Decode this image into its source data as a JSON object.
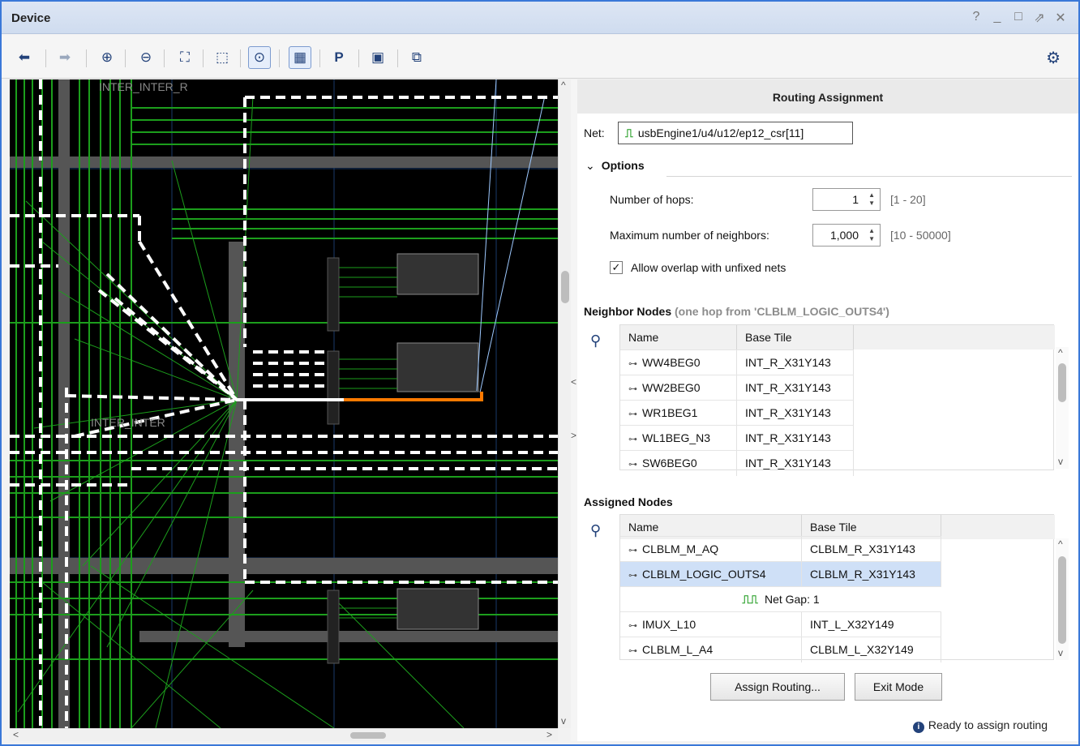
{
  "window": {
    "title": "Device",
    "controls": [
      "?",
      "_",
      "□",
      "⇗",
      "✕"
    ]
  },
  "toolbar": {
    "buttons": [
      {
        "icon": "back-arrow-icon",
        "glyph": "⬅"
      },
      {
        "icon": "forward-arrow-icon",
        "glyph": "➡"
      },
      {
        "icon": "zoom-in-icon",
        "glyph": "⊕"
      },
      {
        "icon": "zoom-out-icon",
        "glyph": "⊖"
      },
      {
        "icon": "zoom-fit-icon",
        "glyph": "⛶"
      },
      {
        "icon": "zoom-selected-icon",
        "glyph": "⬚"
      },
      {
        "icon": "autofit-selection-icon",
        "glyph": "⊙"
      },
      {
        "icon": "routing-resources-icon",
        "glyph": "▦"
      },
      {
        "icon": "add-pblock-icon",
        "glyph": "P"
      },
      {
        "icon": "device-view-options-icon",
        "glyph": "▣"
      },
      {
        "icon": "routing-mode-icon",
        "glyph": "⧉"
      }
    ],
    "settings_icon": "gear-icon"
  },
  "panel": {
    "title": "Routing Assignment",
    "net_label": "Net:",
    "net_value": "usbEngine1/u4/u12/ep12_csr[11]",
    "options": {
      "header": "Options",
      "hops_label": "Number of hops:",
      "hops_value": "1",
      "hops_range": "[1 - 20]",
      "neighbors_label": "Maximum number of neighbors:",
      "neighbors_value": "1,000",
      "neighbors_range": "[10 - 50000]",
      "overlap_label": "Allow overlap with unfixed nets",
      "overlap_checked": true
    },
    "neighbor_nodes": {
      "header": "Neighbor Nodes",
      "subheader": "(one hop from 'CLBLM_LOGIC_OUTS4')",
      "columns": [
        "Name",
        "Base Tile"
      ],
      "rows": [
        {
          "name": "WW4BEG0",
          "tile": "INT_R_X31Y143"
        },
        {
          "name": "WW2BEG0",
          "tile": "INT_R_X31Y143"
        },
        {
          "name": "WR1BEG1",
          "tile": "INT_R_X31Y143"
        },
        {
          "name": "WL1BEG_N3",
          "tile": "INT_R_X31Y143"
        },
        {
          "name": "SW6BEG0",
          "tile": "INT_R_X31Y143"
        }
      ]
    },
    "assigned_nodes": {
      "header": "Assigned Nodes",
      "columns": [
        "Name",
        "Base Tile"
      ],
      "rows": [
        {
          "name": "CLBLM_M_AQ",
          "tile": "CLBLM_R_X31Y143"
        },
        {
          "name": "CLBLM_LOGIC_OUTS4",
          "tile": "CLBLM_R_X31Y143"
        },
        {
          "name": "IMUX_L10",
          "tile": "INT_L_X32Y149"
        },
        {
          "name": "CLBLM_L_A4",
          "tile": "CLBLM_L_X32Y149"
        }
      ],
      "gap_label": "Net Gap: 1"
    },
    "assign_button": "Assign Routing...",
    "exit_button": "Exit Mode",
    "status": "Ready to assign routing"
  },
  "device_view": {
    "tile_labels": [
      "INTER_INTER_R",
      "INTER_INTER"
    ]
  },
  "colors": {
    "wire": "#1c9e1c",
    "highlight": "#ff7a00",
    "selected_row": "#cfe0f7",
    "accent": "#3a78d8"
  }
}
